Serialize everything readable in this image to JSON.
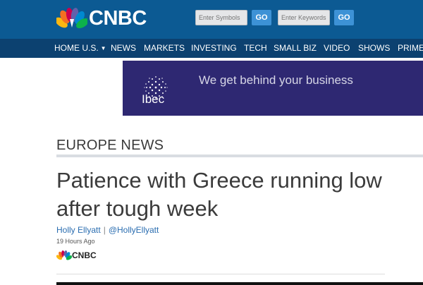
{
  "brand": {
    "name": "CNBC",
    "colors": {
      "header_bg": "#0c5a93",
      "nav_bg": "#0c4170",
      "go_button": "#3d92d6"
    }
  },
  "header": {
    "logo_icon": "peacock-icon",
    "symbols_search": {
      "placeholder": "Enter Symbols",
      "button_label": "GO"
    },
    "keywords_search": {
      "placeholder": "Enter Keywords",
      "button_label": "GO"
    }
  },
  "nav": {
    "items": [
      {
        "label": "HOME U.S."
      },
      {
        "label": "NEWS"
      },
      {
        "label": "MARKETS"
      },
      {
        "label": "INVESTING"
      },
      {
        "label": "TECH"
      },
      {
        "label": "SMALL BIZ"
      },
      {
        "label": "VIDEO"
      },
      {
        "label": "SHOWS"
      },
      {
        "label": "PRIME"
      }
    ],
    "home_caret_icon": "caret-down-icon"
  },
  "ad": {
    "brand": "Ibec",
    "tagline": "We get behind your business",
    "background": "#2e2872"
  },
  "article": {
    "section": "EUROPE NEWS",
    "headline": "Patience with Greece running low after tough week",
    "author": "Holly Ellyatt",
    "separator": "|",
    "twitter": "@HollyEllyatt",
    "time": "19 Hours Ago",
    "source": "CNBC"
  }
}
